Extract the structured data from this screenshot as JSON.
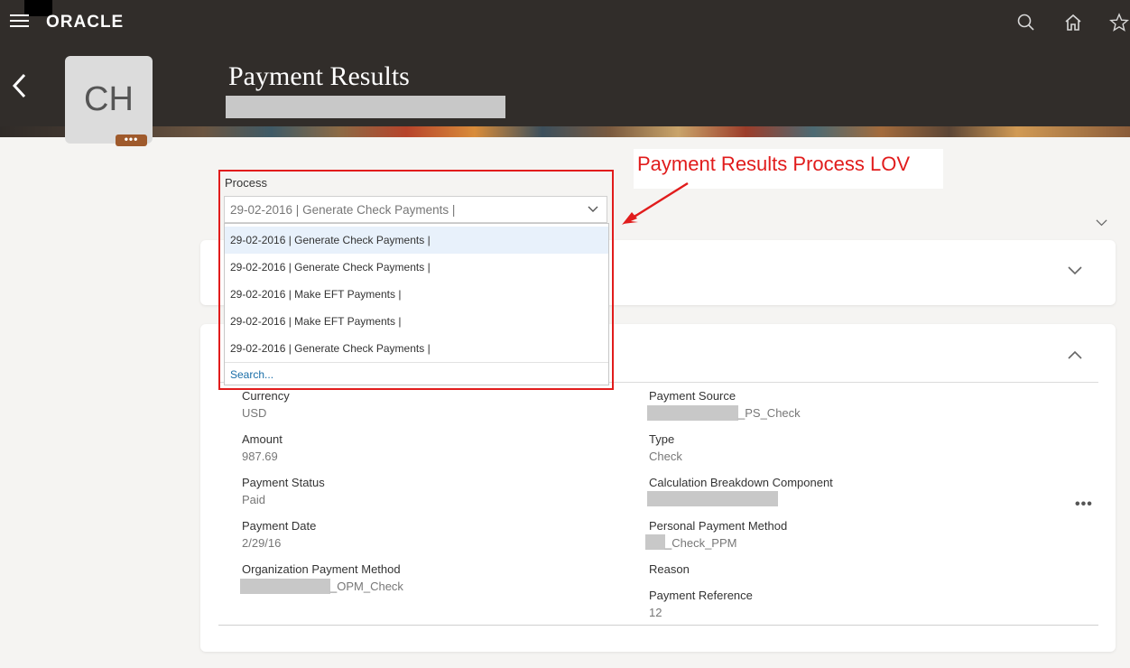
{
  "app": {
    "brand": "ORACLE"
  },
  "header": {
    "title": "Payment Results",
    "avatar_initials": "CH",
    "avatar_more": "•••"
  },
  "process": {
    "label": "Process",
    "value": "29-02-2016 | Generate Check Payments |",
    "options": [
      "29-02-2016 | Generate Check Payments |",
      "29-02-2016 | Generate Check Payments |",
      "29-02-2016 | Make EFT Payments |",
      "29-02-2016 | Make EFT Payments |",
      "29-02-2016 | Generate Check Payments |"
    ],
    "search_link": "Search..."
  },
  "annotation": {
    "text": "Payment Results Process LOV"
  },
  "details": {
    "left": [
      {
        "label": "Currency",
        "value": "USD"
      },
      {
        "label": "Amount",
        "value": "987.69"
      },
      {
        "label": "Payment Status",
        "value": "Paid"
      },
      {
        "label": "Payment Date",
        "value": "2/29/16"
      },
      {
        "label": "Organization Payment Method",
        "value": "_OPM_Check"
      }
    ],
    "right": [
      {
        "label": "Payment Source",
        "value": "_PS_Check"
      },
      {
        "label": "Type",
        "value": "Check"
      },
      {
        "label": "Calculation Breakdown Component",
        "value": ""
      },
      {
        "label": "Personal Payment Method",
        "value": "_Check_PPM"
      },
      {
        "label": "Reason",
        "value": ""
      },
      {
        "label": "Payment Reference",
        "value": "12"
      }
    ],
    "more_label": "•••"
  },
  "colors": {
    "header_bg": "#312d2a",
    "annotation_red": "#e11c1c",
    "link_blue": "#1a6ea8"
  }
}
